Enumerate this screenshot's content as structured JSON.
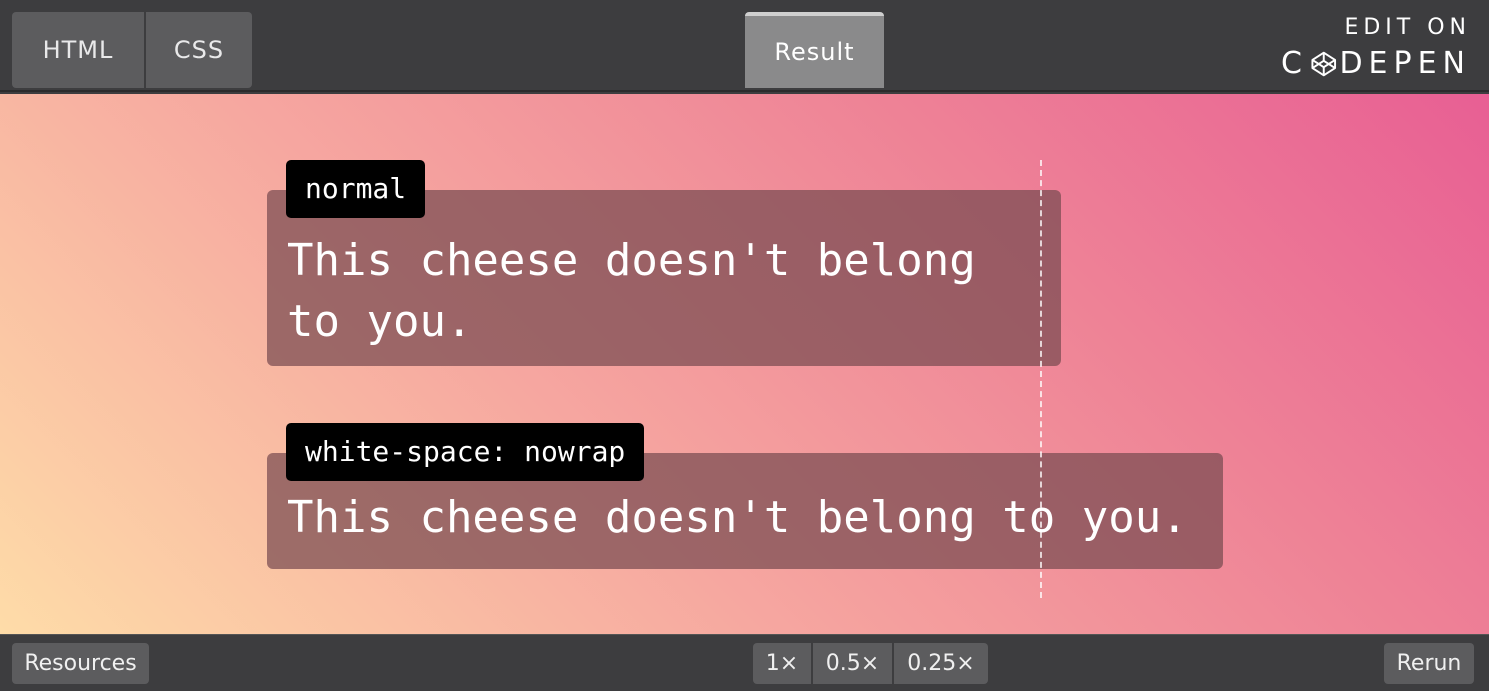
{
  "topbar": {
    "tabs": [
      {
        "label": "HTML"
      },
      {
        "label": "CSS"
      }
    ],
    "result_tab": "Result",
    "edit_on": {
      "top": "EDIT ON",
      "brand_first": "C",
      "brand_rest": "DEPEN"
    }
  },
  "result": {
    "examples": [
      {
        "label": "normal",
        "text": "This cheese doesn't belong to you."
      },
      {
        "label": "white-space: nowrap",
        "text": "This cheese doesn't belong to you."
      }
    ]
  },
  "bottombar": {
    "resources": "Resources",
    "zoom": [
      "1×",
      "0.5×",
      "0.25×"
    ],
    "rerun": "Rerun"
  },
  "colors": {
    "bar": "#3d3d3f",
    "gradient": [
      "#fedca8",
      "#f6a7a0",
      "#ee8296",
      "#e85f94"
    ]
  }
}
